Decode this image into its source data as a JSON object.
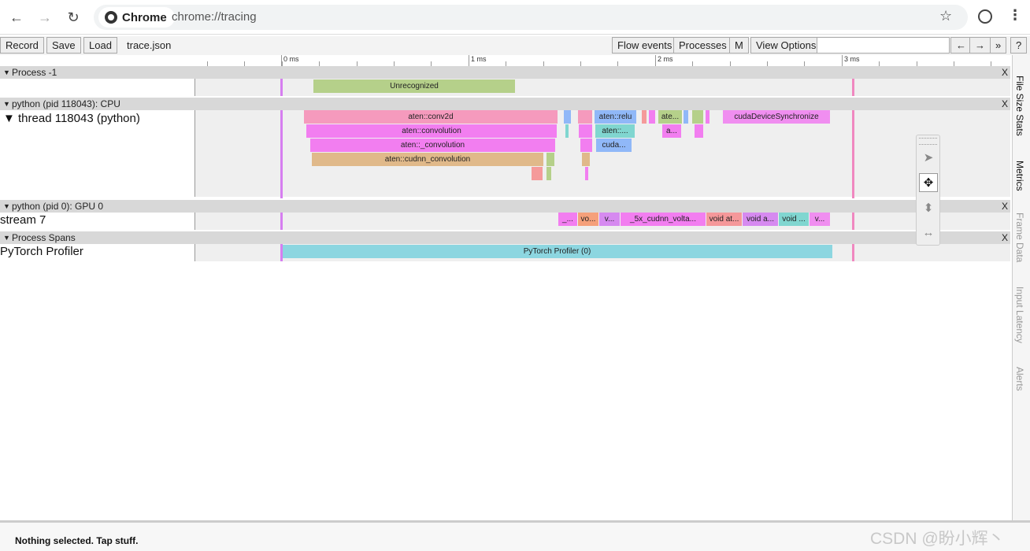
{
  "browser": {
    "app_name": "Chrome",
    "url": "chrome://tracing",
    "back_icon": "←",
    "forward_icon": "→",
    "reload_icon": "↻",
    "star_icon": "☆",
    "menu_icon": "⋮"
  },
  "toolbar": {
    "record_label": "Record",
    "save_label": "Save",
    "load_label": "Load",
    "trace_name": "trace.json",
    "flow_events_label": "Flow events",
    "processes_label": "Processes",
    "m_label": "M",
    "view_options_label": "View Options",
    "search_value": "",
    "prev_label": "←",
    "next_label": "→",
    "more_label": "»",
    "help_label": "?"
  },
  "ruler": {
    "labels": [
      "0 ms",
      "1 ms",
      "2 ms",
      "3 ms"
    ]
  },
  "processes": {
    "p1": {
      "title": "Process -1",
      "close": "X",
      "slice": "Unrecognized"
    },
    "cpu": {
      "title": "python (pid 118043): CPU",
      "close": "X",
      "thread_label": "thread 118043 (python)",
      "slices": [
        "aten::conv2d",
        "aten::convolution",
        "aten::_convolution",
        "aten::cudnn_convolution",
        "aten::relu",
        "aten::...",
        "cuda...",
        "ate...",
        "a...",
        "cudaDeviceSynchronize"
      ]
    },
    "gpu": {
      "title": "python (pid 0): GPU 0",
      "close": "X",
      "stream_label": "stream 7",
      "slices": [
        "_...",
        "vo...",
        "v...",
        "_5x_cudnn_volta...",
        "void at...",
        "void a...",
        "void ...",
        "v..."
      ]
    },
    "spans": {
      "title": "Process Spans",
      "close": "X",
      "label": "PyTorch Profiler",
      "slice": "PyTorch Profiler (0)"
    }
  },
  "side_tabs": [
    "File Size Stats",
    "Metrics",
    "Frame Data",
    "Input Latency",
    "Alerts"
  ],
  "status": {
    "text": "Nothing selected. Tap stuff."
  },
  "watermark": "CSDN @盼小辉丶",
  "colors": {
    "vsync_purple": "#d67ef0",
    "vsync_pink": "#f088c0",
    "unrecognized": "#b5d08a",
    "conv2d": "#f59abd",
    "convolution": "#f27ef0",
    "cudnn": "#e0b98a",
    "relu": "#90b8f8",
    "aten_teal": "#80d6d0",
    "sync": "#f08ef0",
    "pytorch_profiler": "#8cd6e0"
  }
}
